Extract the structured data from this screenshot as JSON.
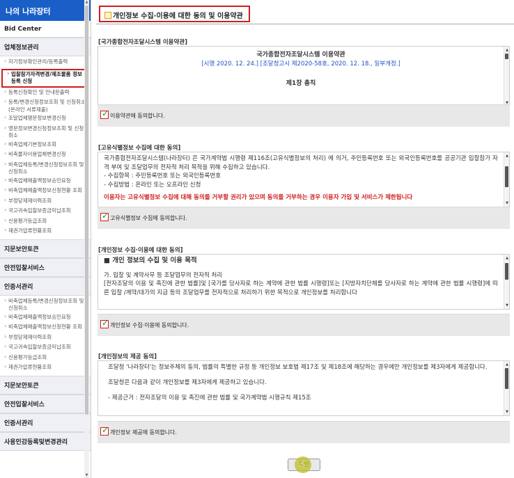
{
  "sidebar": {
    "header": "나의 나라장터",
    "bid_center": "Bid Center",
    "section1": "업체정보관리",
    "items1": [
      "자기정보확인관리/등록출력",
      "입찰참가자격변경/제조물품 정보 등록 신청",
      "등록신청확인 및 안내문출력",
      "등록/변경신청정보조회 및 신청취소(온라인 서류제출)",
      "조달업체명문정보변경신청",
      "영문정보변경신청정보조회 및 신청취소",
      "비축업체기본정보조회",
      "비축물자이용업체변경신청",
      "비축업체등록/변경신청정보조회 및 신청취소",
      "비축업체매출액정보승인요청",
      "비축업체매출액정보신청현황 조회",
      "부정당제재이력조회",
      "국고귀속입찰보증금미납조회",
      "신용평가등급조회",
      "재권가압류현황조회"
    ],
    "section2": "지문보안토큰",
    "section3": "안전입찰서비스",
    "section4": "인증서관리",
    "items2": [
      "비축업체등록/변경신청정보조회 및 신청취소",
      "비축업체매출액정보승인요청",
      "비축업체매출액정보신청현황 조회",
      "부정당제재이력조회",
      "국고귀속입찰보증금미납조회",
      "신용평가등급조회",
      "재권가압류현황조회"
    ],
    "section5": "지문보안토큰",
    "section6": "안전입찰서비스",
    "section7": "인증서관리",
    "section8": "사용인감등록및변경관리"
  },
  "page_title": "개인정보 수집·이용에 대한 동의 및 이용약관",
  "terms": {
    "label": "[국가종합전자조달시스템 이용약관]",
    "heading": "국가종합전자조달시스템 이용약관",
    "effective": "[시행 2020. 12. 24.] [조달청고시 제2020-58호, 2020. 12. 18., 일부개정.]",
    "chapter": "제1장 총칙",
    "agree": "이용약관에 동의합니다."
  },
  "unique_id": {
    "label": "[고유식별정보 수집에 대한 동의]",
    "p1": "국가종합전자조달시스템(나라장터) 은 국가계약법 시행령 제116조(고유식별정보의 처리) 에 의거, 주민등록번호 또는 외국인등록번호를 공공기관 입찰참가 자격 부여 및 조달업무의 전자적 처리 목적을 위해 수집하고 있습니다.",
    "l1": "- 수집항목 : 주민등록번호 또는 외국인등록번호",
    "l2": "- 수집방법 : 온라인 또는 오프라인 신청",
    "warn": "이용자는 고유식별정보 수집에 대해 동의를 거부할 권리가 있으며 동의를 거부하는 경우 이용자 가입 및 서비스가 제한됩니다",
    "agree": "고유식별정보 수집에 동의합니다."
  },
  "personal": {
    "label": "[개인정보 수집·이용에 대한 동의]",
    "heading": "■ 개인 정보의 수집 및 이용 목적",
    "p1": "가. 입찰 및 계약사무 등 조달업무의 전자적 처리",
    "p2": "[전자조달의 이용 및 촉진에 관한 법률]및 [국가를 당사자로 하는 계약에 관한 법률 시행령]또는 [지방자치단체를 당사자로 하는 계약에 관한 법률 시행령]에 따른 입찰 /계약/대가의 지급 등의 조달업무를 전자적으로 처리하기 위한 목적으로 개인정보를 처리합니다",
    "agree": "개인정보 수집·이용에 동의합니다."
  },
  "provision": {
    "label": "[개인정보의 제공 동의]",
    "p1": "조달청 '나라장터'는 정보주체의 동의, 법률의 특별한 규정 등 개인정보 보호법 제17조 및 제18조에 해당하는 경우에만 개인정보를 제3자에게 제공합니다.",
    "p2": "조달청은 다음과 같이 개인정보를 제3자에게 제공하고 있습니다.",
    "p3": "- 제공근거 : 전자조달의 이용 및 촉진에 관한 법률 및 국가계약법 시행규칙 제15조",
    "agree": "개인정보 제공에 동의합니다."
  },
  "confirm_button": "확인"
}
